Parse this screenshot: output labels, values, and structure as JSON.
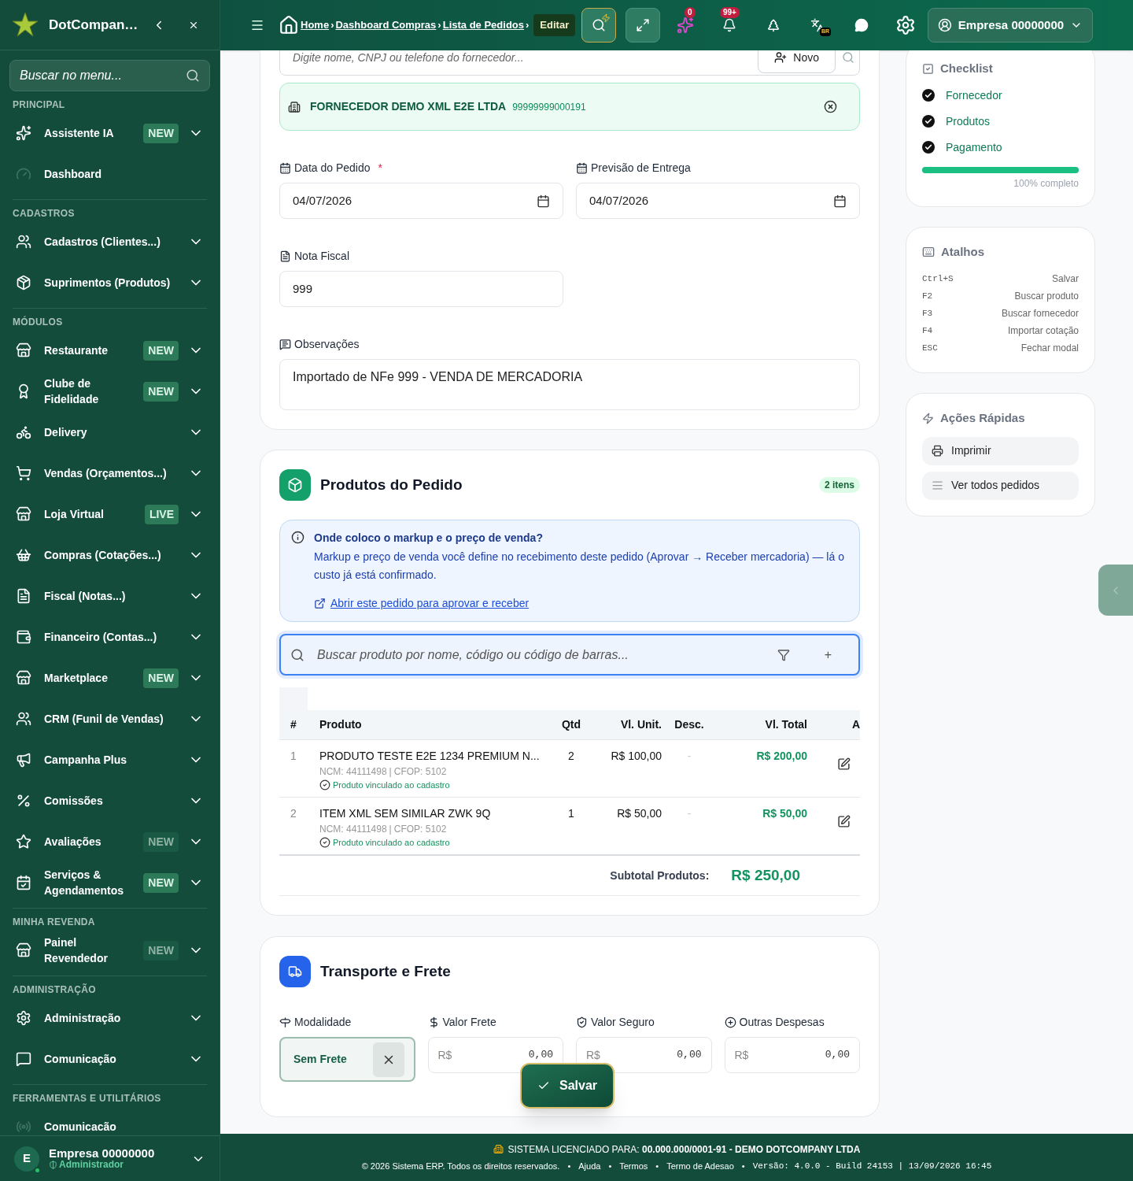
{
  "sidebar": {
    "brand": "DotCompan…",
    "search_placeholder": "Buscar no menu...",
    "sections": [
      {
        "title": "PRINCIPAL",
        "items": [
          {
            "label": "Assistente IA",
            "badge": "NEW",
            "highlighted": true,
            "expandable": true
          },
          {
            "label": "Dashboard",
            "expandable": false
          }
        ]
      },
      {
        "title": "CADASTROS",
        "items": [
          {
            "label": "Cadastros (Clientes...)",
            "expandable": true
          },
          {
            "label": "Suprimentos (Produtos)",
            "expandable": true
          }
        ]
      },
      {
        "title": "MÓDULOS",
        "items": [
          {
            "label": "Restaurante",
            "badge": "NEW",
            "highlighted": true,
            "expandable": true
          },
          {
            "label": "Clube de Fidelidade",
            "badge": "NEW",
            "highlighted": true,
            "expandable": true
          },
          {
            "label": "Delivery",
            "expandable": true
          },
          {
            "label": "Vendas (Orçamentos...)",
            "expandable": true
          },
          {
            "label": "Loja Virtual",
            "badge": "LIVE",
            "highlighted": true,
            "expandable": true
          },
          {
            "label": "Compras (Cotações...)",
            "expandable": true
          },
          {
            "label": "Fiscal (Notas...)",
            "expandable": true
          },
          {
            "label": "Financeiro (Contas...)",
            "expandable": true
          },
          {
            "label": "Marketplace",
            "badge": "NEW",
            "highlighted": true,
            "expandable": true
          },
          {
            "label": "CRM (Funil de Vendas)",
            "expandable": true
          },
          {
            "label": "Campanha Plus",
            "expandable": true
          },
          {
            "label": "Comissões",
            "expandable": true
          },
          {
            "label": "Avaliações",
            "badge": "NEW",
            "highlighted": false,
            "expandable": true
          },
          {
            "label": "Serviços & Agendamentos",
            "badge": "NEW",
            "highlighted": true,
            "expandable": true
          }
        ]
      },
      {
        "title": "MINHA REVENDA",
        "items": [
          {
            "label": "Painel Revendedor",
            "badge": "NEW",
            "highlighted": false,
            "expandable": true
          }
        ]
      },
      {
        "title": "ADMINISTRAÇÃO",
        "items": [
          {
            "label": "Administração",
            "expandable": true
          },
          {
            "label": "Comunicação",
            "expandable": true
          }
        ]
      },
      {
        "title": "FERRAMENTAS E UTILITÁRIOS",
        "items": [
          {
            "label": "Comunicacão",
            "expandable": false
          }
        ]
      }
    ],
    "user": {
      "initial": "E",
      "name": "Empresa 00000000",
      "role": "Administrador",
      "online": true
    }
  },
  "header": {
    "breadcrumbs": [
      "Home",
      "Dashboard Compras",
      "Lista de Pedidos",
      "Editar"
    ],
    "separator": "›",
    "ai_badge": "0",
    "notifications_badge": "99+",
    "language_badge": "BR",
    "account": "Empresa 00000000"
  },
  "order": {
    "supplier_placeholder": "Digite nome, CNPJ ou telefone do fornecedor...",
    "new_button": "Novo",
    "supplier": {
      "name": "FORNECEDOR DEMO XML E2E LTDA",
      "document": "99999999000191"
    },
    "required_mark": "*",
    "fields": [
      {
        "label": "Data do Pedido",
        "required": true,
        "value": "04/07/2026",
        "kind": "date"
      },
      {
        "label": "Previsão de Entrega",
        "required": false,
        "value": "04/07/2026",
        "kind": "date"
      }
    ],
    "invoice": {
      "label": "Nota Fiscal",
      "value": "999"
    },
    "notes": {
      "label": "Observações",
      "value": "Importado de NFe 999 - VENDA DE MERCADORIA"
    }
  },
  "products": {
    "title": "Produtos do Pedido",
    "count": "2 itens",
    "info": {
      "title": "Onde coloco o markup e o preço de venda?",
      "text": "Markup e preço de venda você define no recebimento deste pedido (Aprovar → Receber mercadoria) — lá o custo já está confirmado.",
      "link": "Abrir este pedido para aprovar e receber"
    },
    "search_placeholder": "Buscar produto por nome, código ou código de barras...",
    "add_symbol": "+",
    "columns": [
      "#",
      "Produto",
      "Qtd",
      "Vl. Unit.",
      "Desc.",
      "Vl. Total",
      "A"
    ],
    "code_separator": "|",
    "rows": [
      {
        "index": "1",
        "name": "PRODUTO TESTE E2E 1234 PREMIUM N...",
        "ncm": "NCM: 44111498",
        "cfop": "CFOP: 5102",
        "status": "Produto vinculado ao cadastro",
        "qty": "2",
        "unit": "R$ 100,00",
        "discount": "-",
        "total": "R$ 200,00"
      },
      {
        "index": "2",
        "name": "ITEM XML SEM SIMILAR ZWK 9Q",
        "ncm": "NCM: 44111498",
        "cfop": "CFOP: 5102",
        "status": "Produto vinculado ao cadastro",
        "qty": "1",
        "unit": "R$ 50,00",
        "discount": "-",
        "total": "R$ 50,00"
      }
    ],
    "subtotal_label": "Subtotal Produtos:",
    "subtotal": "R$ 250,00"
  },
  "transport": {
    "title": "Transporte e Frete",
    "mode": {
      "label": "Modalidade",
      "value": "Sem Frete"
    },
    "amounts": [
      {
        "label": "Valor Frete",
        "prefix": "R$",
        "value": "0,00"
      },
      {
        "label": "Valor Seguro",
        "prefix": "R$",
        "value": "0,00"
      },
      {
        "label": "Outras Despesas",
        "prefix": "R$",
        "value": "0,00"
      }
    ]
  },
  "save_button": "Salvar",
  "checklist": {
    "title": "Checklist",
    "items": [
      {
        "label": "Fornecedor",
        "checked": true
      },
      {
        "label": "Produtos",
        "checked": true
      },
      {
        "label": "Pagamento",
        "checked": true
      }
    ],
    "level": 1,
    "caption": "100% completo"
  },
  "shortcuts": {
    "title": "Atalhos",
    "items": [
      {
        "key": "Ctrl+S",
        "action": "Salvar"
      },
      {
        "key": "F2",
        "action": "Buscar produto"
      },
      {
        "key": "F3",
        "action": "Buscar fornecedor"
      },
      {
        "key": "F4",
        "action": "Importar cotação"
      },
      {
        "key": "ESC",
        "action": "Fechar modal"
      }
    ]
  },
  "quick_actions": {
    "title": "Ações Rápidas",
    "items": [
      "Imprimir",
      "Ver todos pedidos"
    ]
  },
  "footer": {
    "license": "SISTEMA LICENCIADO PARA: **00.000.000/0001-91 - DEMO DOTCOMPANY LTDA**",
    "copyright": "© 2026 Sistema ERP. Todos os direitos reservados.",
    "separator": "•",
    "links": [
      "Ajuda",
      "Termos",
      "Termo de Adesao"
    ],
    "version": "Versão: 4.0.0 - Build 24153 | 13/09/2026 16:45"
  }
}
